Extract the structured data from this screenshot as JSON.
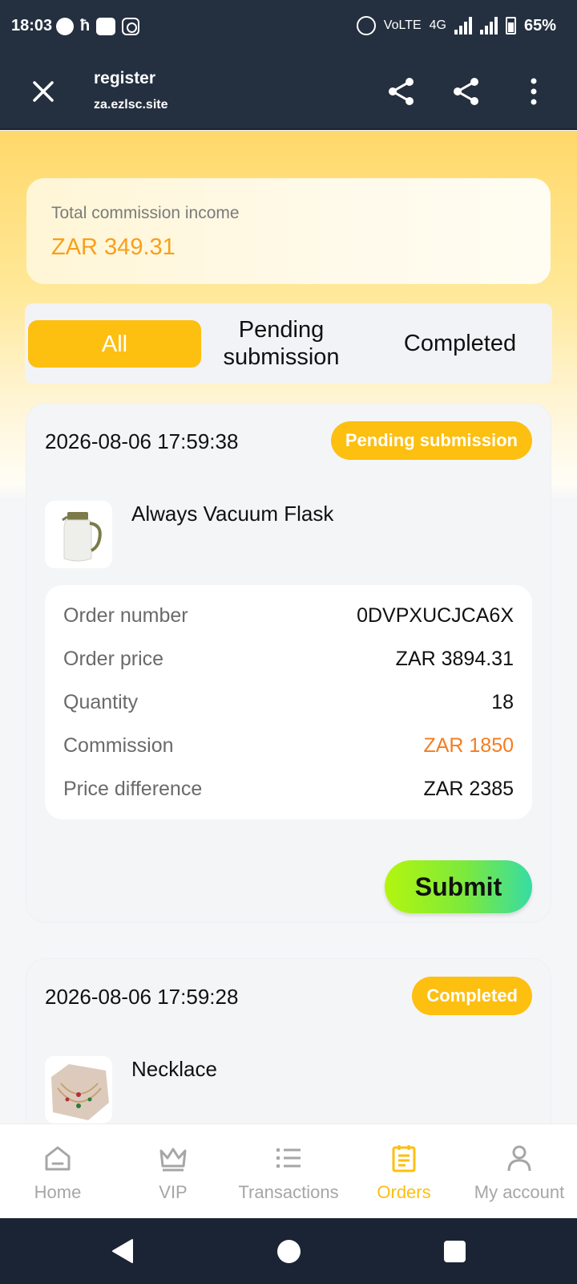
{
  "status_bar": {
    "time": "18:03",
    "network": "VoLTE",
    "network_type": "4G",
    "battery": "65%"
  },
  "browser": {
    "title": "register",
    "url": "za.ezlsc.site"
  },
  "income": {
    "label": "Total commission income",
    "value": "ZAR 349.31"
  },
  "tabs": [
    {
      "label": "All",
      "active": true
    },
    {
      "label": "Pending submission",
      "active": false
    },
    {
      "label": "Completed",
      "active": false
    }
  ],
  "orders": [
    {
      "date": "2026-08-06 17:59:38",
      "status": "Pending submission",
      "product": "Always Vacuum Flask",
      "details": {
        "order_number_label": "Order number",
        "order_number": "0DVPXUCJCA6X",
        "order_price_label": "Order price",
        "order_price": "ZAR 3894.31",
        "quantity_label": "Quantity",
        "quantity": "18",
        "commission_label": "Commission",
        "commission": "ZAR 1850",
        "price_difference_label": "Price difference",
        "price_difference": "ZAR 2385"
      },
      "action": "Submit"
    },
    {
      "date": "2026-08-06 17:59:28",
      "status": "Completed",
      "product": "Necklace"
    }
  ],
  "bottom_nav": [
    {
      "label": "Home",
      "icon": "home-icon",
      "active": false
    },
    {
      "label": "VIP",
      "icon": "crown-icon",
      "active": false
    },
    {
      "label": "Transactions",
      "icon": "list-icon",
      "active": false
    },
    {
      "label": "Orders",
      "icon": "clipboard-icon",
      "active": true
    },
    {
      "label": "My account",
      "icon": "person-icon",
      "active": false
    }
  ],
  "colors": {
    "accent": "#fdbf10",
    "commission": "#f57c1f",
    "income": "#f7a01c",
    "header": "#243040"
  }
}
